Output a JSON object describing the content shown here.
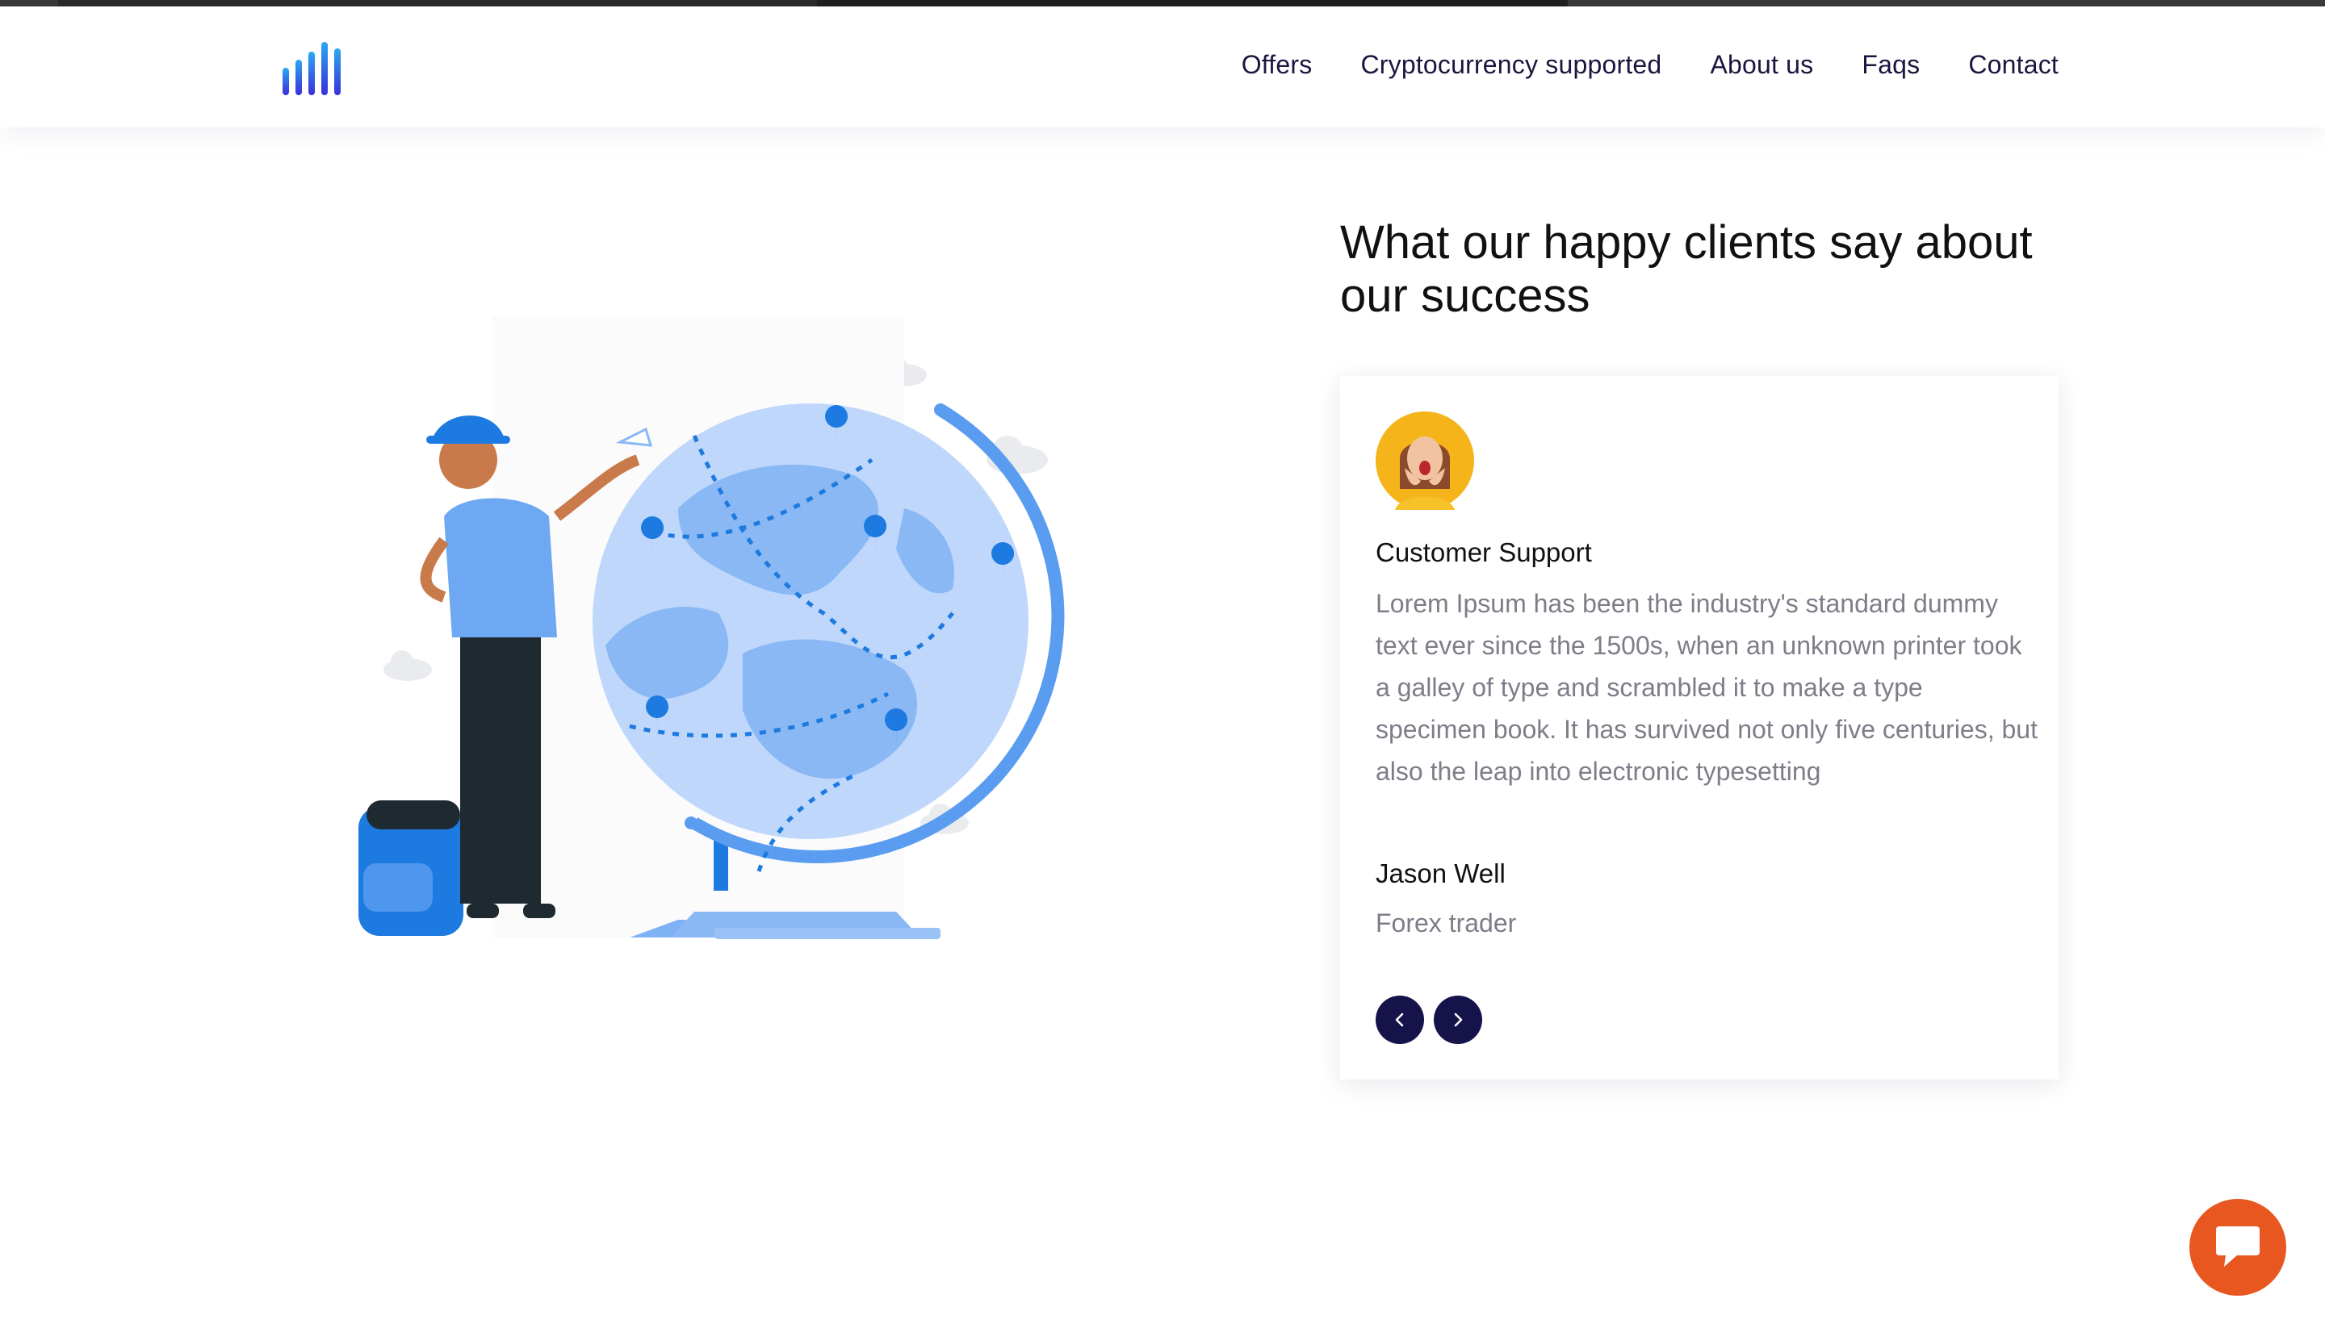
{
  "nav": {
    "items": [
      {
        "label": "Offers"
      },
      {
        "label": "Cryptocurrency supported"
      },
      {
        "label": "About us"
      },
      {
        "label": "Faqs"
      },
      {
        "label": "Contact"
      }
    ]
  },
  "testimonials": {
    "heading": "What our happy clients say about our success",
    "card": {
      "role": "Customer Support",
      "quote": "Lorem Ipsum has been the industry's standard dummy text ever since the 1500s, when an unknown printer took a galley of type and scrambled it to make a type specimen book. It has survived not only five centuries, but also the leap into electronic typesetting",
      "name": "Jason Well",
      "job": "Forex trader"
    }
  },
  "colors": {
    "accent_dark": "#16124a",
    "chat_button": "#e8571f",
    "globe_blue": "#5a9cf0"
  },
  "icons": {
    "logo": "bar-chart-logo",
    "prev": "chevron-left-icon",
    "next": "chevron-right-icon",
    "chat": "chat-bubble-icon"
  }
}
